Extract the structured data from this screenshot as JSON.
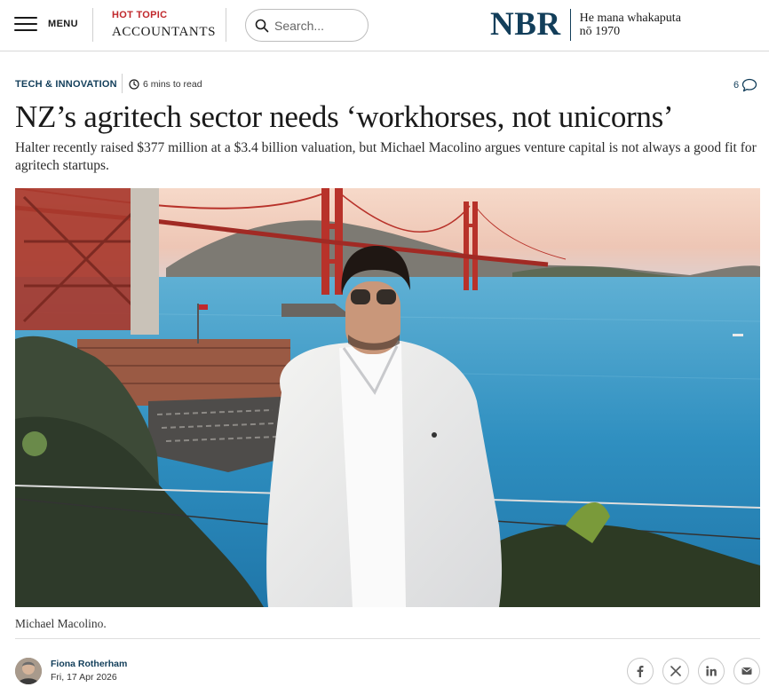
{
  "header": {
    "menu_label": "MENU",
    "hot_topic_label": "HOT TOPIC",
    "hot_topic": "ACCOUNTANTS",
    "search_placeholder": "Search...",
    "logo_text": "NBR",
    "logo_tagline_1": "He mana whakaputa",
    "logo_tagline_2": "nō 1970",
    "brand_color": "#123e5a",
    "accent_color": "#c0282c"
  },
  "article": {
    "section": "TECH & INNOVATION",
    "read_time": "6 mins to read",
    "comment_count": "6",
    "headline": "NZ’s agritech sector needs ‘workhorses, not unicorns’",
    "standfirst": "Halter recently raised $377 million at a $3.4 billion valuation, but Michael Macolino argues venture capital is not always a good fit for agritech startups.",
    "image_caption": "Michael Macolino.",
    "author": "Fiona Rotherham",
    "date": "Fri, 17 Apr 2026"
  },
  "icons": {
    "menu": "hamburger-icon",
    "search": "search-icon",
    "clock": "clock-icon",
    "comments": "comment-bubble-icon",
    "share": [
      "facebook-icon",
      "x-icon",
      "linkedin-icon",
      "email-icon"
    ]
  }
}
